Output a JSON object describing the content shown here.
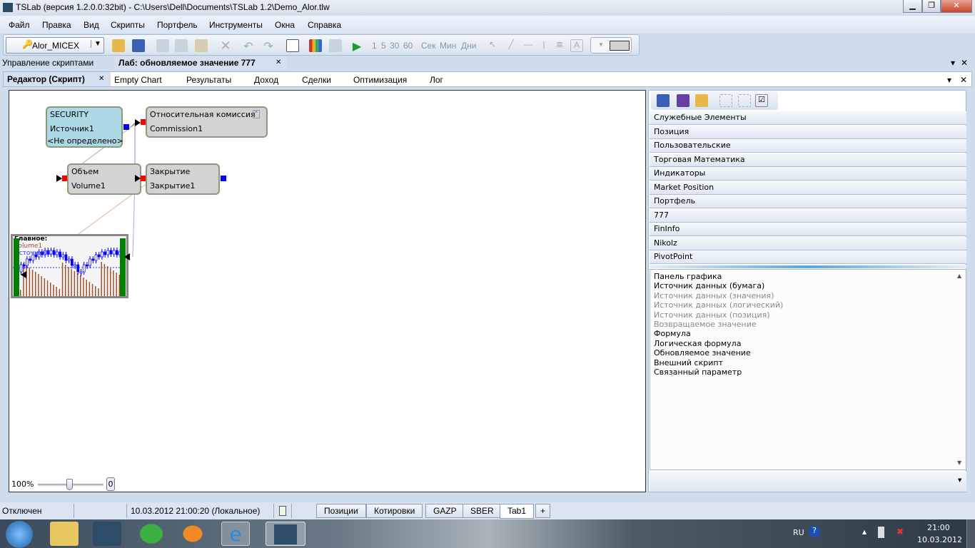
{
  "window": {
    "title": "TSLab (версия 1.2.0.0:32bit) - C:\\Users\\Dell\\Documents\\TSLab 1.2\\Demo_Alor.tlw",
    "minimize": "▁",
    "maximize": "❐",
    "close": "✕"
  },
  "menu": [
    "Файл",
    "Правка",
    "Вид",
    "Скрипты",
    "Портфель",
    "Инструменты",
    "Окна",
    "Справка"
  ],
  "toolbar": {
    "connection": "Alor_MICEX",
    "intervals": [
      "1",
      "5",
      "30",
      "60"
    ],
    "units": [
      "Сек",
      "Мин",
      "Дни"
    ]
  },
  "doc_tabs": {
    "scripts": "Управление скриптами",
    "lab": "Лаб: обновляемое значение 777",
    "close": "✕",
    "pin": "▾",
    "close_all": "✕"
  },
  "inner_tabs": {
    "items": [
      "Редактор (Скрипт)",
      "Empty Chart",
      "Результаты",
      "Доход",
      "Сделки",
      "Оптимизация",
      "Лог"
    ],
    "close": "✕"
  },
  "nodes": {
    "security": {
      "type": "SECURITY",
      "name": "Источник1",
      "value": "<Не определено>"
    },
    "commission": {
      "type": "Относительная комиссия",
      "name": "Commission1"
    },
    "volume": {
      "type": "Объем",
      "name": "Volume1"
    },
    "close": {
      "type": "Закрытие",
      "name": "Закрытие1"
    },
    "chart": {
      "title": "Главное:",
      "series": [
        "Volume1",
        "Источник1"
      ]
    }
  },
  "zoom": {
    "value": "100%",
    "reset": "0",
    "level": 50
  },
  "palette": {
    "categories": [
      "Служебные Элементы",
      "Позиция",
      "Пользовательские",
      "Торговая Математика",
      "Индикаторы",
      "Market Position",
      "Портфель",
      "777",
      "FinInfo",
      "Nikolz",
      "PivotPoint"
    ],
    "items": [
      {
        "label": "Панель графика",
        "enabled": true
      },
      {
        "label": "Источник данных (бумага)",
        "enabled": true
      },
      {
        "label": "Источник данных (значения)",
        "enabled": false
      },
      {
        "label": "Источник данных (логический)",
        "enabled": false
      },
      {
        "label": "Источник данных (позиция)",
        "enabled": false
      },
      {
        "label": "Возвращаемое значение",
        "enabled": false
      },
      {
        "label": "Формула",
        "enabled": true
      },
      {
        "label": "Логическая формула",
        "enabled": true
      },
      {
        "label": "Обновляемое значение",
        "enabled": true
      },
      {
        "label": "Внешний скрипт",
        "enabled": true
      },
      {
        "label": "Связанный параметр",
        "enabled": true
      }
    ]
  },
  "status": {
    "connection": "Отключен",
    "datetime": "10.03.2012 21:00:20 (Локальное)",
    "tabs": [
      "Позиции",
      "Котировки",
      "GAZP",
      "SBER",
      "Tab1"
    ],
    "add": "+"
  },
  "tray": {
    "lang": "RU",
    "time": "21:00",
    "date": "10.03.2012"
  },
  "colors": {
    "security_node": "#add8e6",
    "node": "#d3d3d3",
    "input_port": "#ff0000",
    "output_port": "#0000ff",
    "chart_bar": "#008000"
  }
}
